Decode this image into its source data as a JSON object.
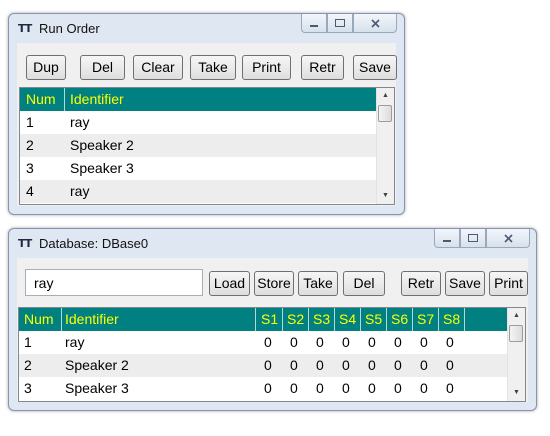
{
  "run_order": {
    "title": "Run Order",
    "toolbar": [
      "Dup",
      "Del",
      "Clear",
      "Take",
      "Print",
      "Retr",
      "Save"
    ],
    "columns": [
      "Num",
      "Identifier"
    ],
    "rows": [
      {
        "num": "1",
        "id": "ray"
      },
      {
        "num": "2",
        "id": "Speaker 2"
      },
      {
        "num": "3",
        "id": "Speaker 3"
      },
      {
        "num": "4",
        "id": "ray"
      }
    ]
  },
  "database": {
    "title": "Database: DBase0",
    "search_value": "ray",
    "toolbar": [
      "Load",
      "Store",
      "Take",
      "Del",
      "Retr",
      "Save",
      "Print"
    ],
    "columns": [
      "Num",
      "Identifier",
      "S1",
      "S2",
      "S3",
      "S4",
      "S5",
      "S6",
      "S7",
      "S8"
    ],
    "rows": [
      {
        "num": "1",
        "id": "ray",
        "s": [
          "0",
          "0",
          "0",
          "0",
          "0",
          "0",
          "0",
          "0"
        ]
      },
      {
        "num": "2",
        "id": "Speaker 2",
        "s": [
          "0",
          "0",
          "0",
          "0",
          "0",
          "0",
          "0",
          "0"
        ]
      },
      {
        "num": "3",
        "id": "Speaker 3",
        "s": [
          "0",
          "0",
          "0",
          "0",
          "0",
          "0",
          "0",
          "0"
        ]
      }
    ]
  },
  "icons": {
    "window_icon": "TT",
    "minimize": "minimize-icon",
    "maximize": "maximize-icon",
    "close": "close-icon",
    "scroll_up": "▲",
    "scroll_down": "▼"
  },
  "colors": {
    "header_bg": "#008080",
    "header_text": "#ffff00",
    "alt_row": "#ededed",
    "frame": "#dfe8f2"
  }
}
